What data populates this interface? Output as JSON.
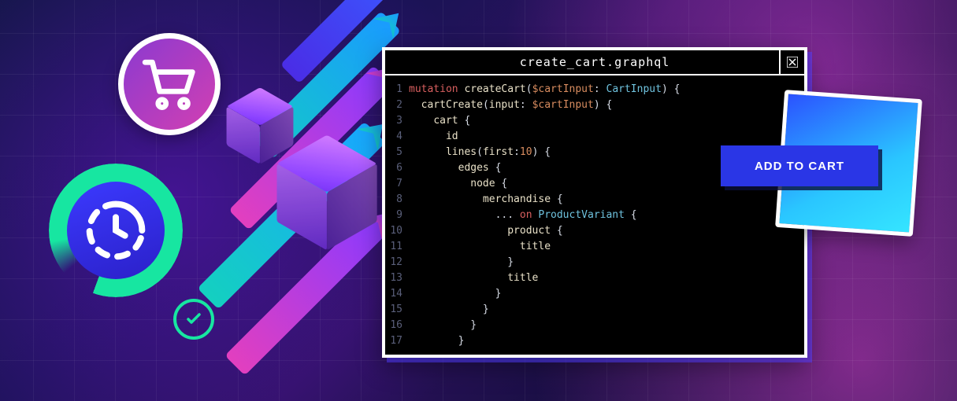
{
  "editor": {
    "filename": "create_cart.graphql",
    "lines": [
      {
        "n": 1,
        "indent": 0,
        "tokens": [
          [
            "kw",
            "mutation"
          ],
          [
            "sp",
            " "
          ],
          [
            "fn",
            "createCart"
          ],
          [
            "pun",
            "("
          ],
          [
            "var",
            "$cartInput"
          ],
          [
            "pun",
            ": "
          ],
          [
            "type",
            "CartInput"
          ],
          [
            "pun",
            ") {"
          ]
        ]
      },
      {
        "n": 2,
        "indent": 1,
        "tokens": [
          [
            "fn",
            "cartCreate"
          ],
          [
            "pun",
            "("
          ],
          [
            "field",
            "input"
          ],
          [
            "pun",
            ": "
          ],
          [
            "var",
            "$cartInput"
          ],
          [
            "pun",
            ") {"
          ]
        ]
      },
      {
        "n": 3,
        "indent": 2,
        "tokens": [
          [
            "field",
            "cart"
          ],
          [
            "pun",
            " {"
          ]
        ]
      },
      {
        "n": 4,
        "indent": 3,
        "tokens": [
          [
            "field",
            "id"
          ]
        ]
      },
      {
        "n": 5,
        "indent": 3,
        "tokens": [
          [
            "field",
            "lines"
          ],
          [
            "pun",
            "("
          ],
          [
            "field",
            "first"
          ],
          [
            "pun",
            ":"
          ],
          [
            "num",
            "10"
          ],
          [
            "pun",
            ") {"
          ]
        ]
      },
      {
        "n": 6,
        "indent": 4,
        "tokens": [
          [
            "field",
            "edges"
          ],
          [
            "pun",
            " {"
          ]
        ]
      },
      {
        "n": 7,
        "indent": 5,
        "tokens": [
          [
            "field",
            "node"
          ],
          [
            "pun",
            " {"
          ]
        ]
      },
      {
        "n": 8,
        "indent": 6,
        "tokens": [
          [
            "field",
            "merchandise"
          ],
          [
            "pun",
            " {"
          ]
        ]
      },
      {
        "n": 9,
        "indent": 7,
        "tokens": [
          [
            "pun",
            "... "
          ],
          [
            "kw",
            "on"
          ],
          [
            "sp",
            " "
          ],
          [
            "type",
            "ProductVariant"
          ],
          [
            "pun",
            " {"
          ]
        ]
      },
      {
        "n": 10,
        "indent": 8,
        "tokens": [
          [
            "field",
            "product"
          ],
          [
            "pun",
            " {"
          ]
        ]
      },
      {
        "n": 11,
        "indent": 9,
        "tokens": [
          [
            "field",
            "title"
          ]
        ]
      },
      {
        "n": 12,
        "indent": 8,
        "tokens": [
          [
            "pun",
            "}"
          ]
        ]
      },
      {
        "n": 13,
        "indent": 8,
        "tokens": [
          [
            "field",
            "title"
          ]
        ]
      },
      {
        "n": 14,
        "indent": 7,
        "tokens": [
          [
            "pun",
            "}"
          ]
        ]
      },
      {
        "n": 15,
        "indent": 6,
        "tokens": [
          [
            "pun",
            "}"
          ]
        ]
      },
      {
        "n": 16,
        "indent": 5,
        "tokens": [
          [
            "pun",
            "}"
          ]
        ]
      },
      {
        "n": 17,
        "indent": 4,
        "tokens": [
          [
            "pun",
            "}"
          ]
        ]
      }
    ]
  },
  "button": {
    "label": "ADD TO CART"
  },
  "icons": {
    "cart": "cart-icon",
    "clock": "clock-icon",
    "check": "check-icon",
    "close": "close-icon"
  }
}
